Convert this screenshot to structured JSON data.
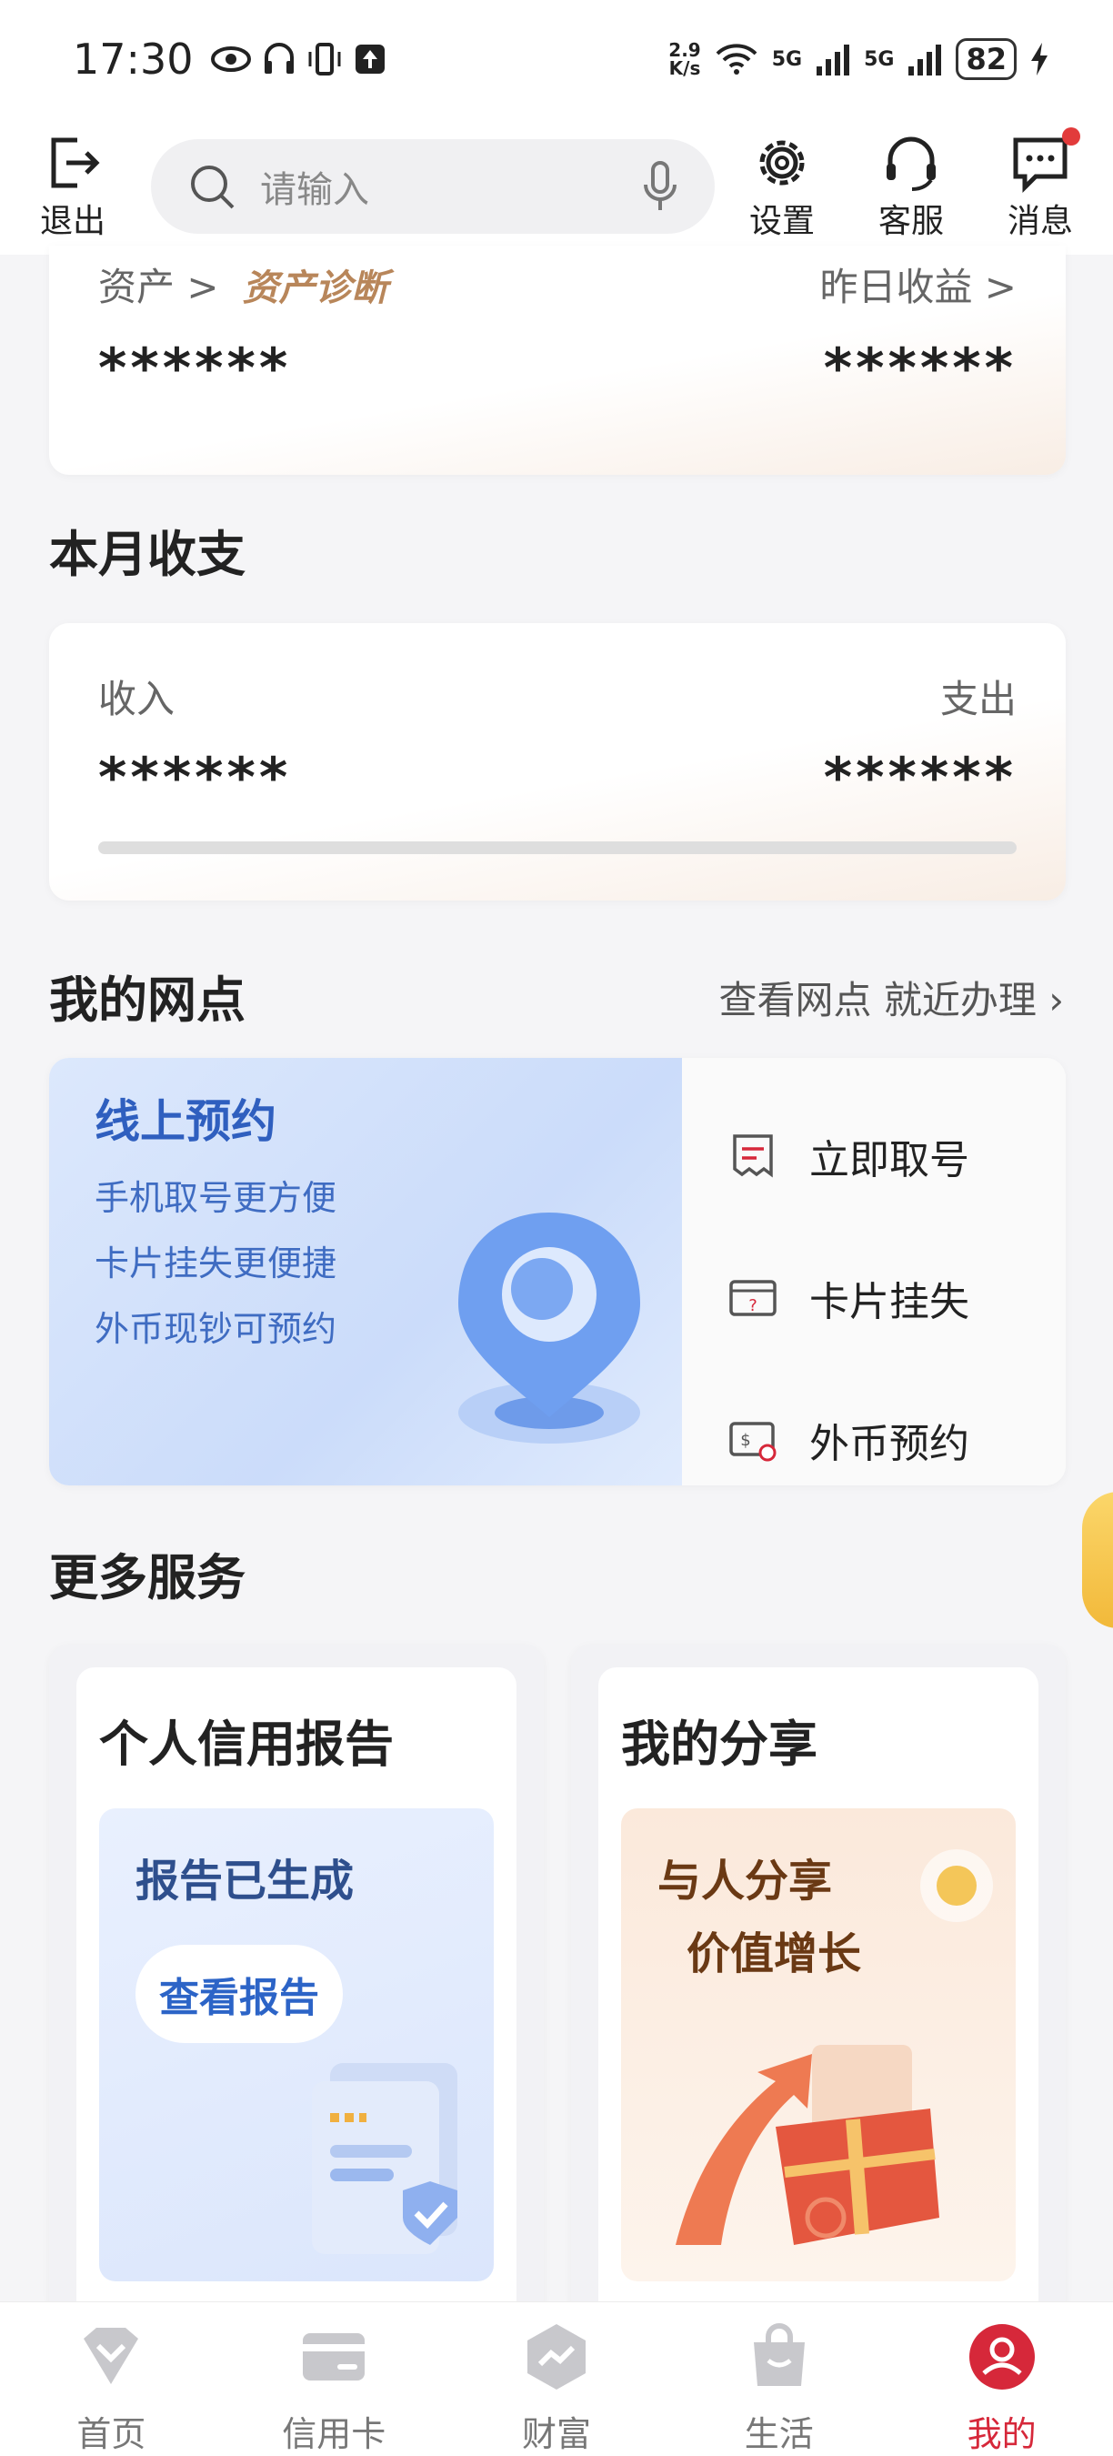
{
  "status_bar": {
    "time": "17:30",
    "speed_value": "2.9",
    "speed_unit": "K/s",
    "network1": "5G",
    "network2": "5G",
    "battery": "82"
  },
  "header": {
    "logout_label": "退出",
    "search_placeholder": "请输入",
    "settings_label": "设置",
    "service_label": "客服",
    "message_label": "消息"
  },
  "asset_card": {
    "asset_label": "资产 >",
    "diagnosis_label": "资产诊断",
    "yesterday_label": "昨日收益 >",
    "asset_value": "******",
    "yesterday_value": "******"
  },
  "monthly": {
    "title": "本月收支",
    "income_label": "收入",
    "expense_label": "支出",
    "income_value": "******",
    "expense_value": "******"
  },
  "branch": {
    "title": "我的网点",
    "link": "查看网点 就近办理",
    "online_title": "线上预约",
    "online_lines": [
      "手机取号更方便",
      "卡片挂失更便捷",
      "外币现钞可预约"
    ],
    "actions": [
      "立即取号",
      "卡片挂失",
      "外币预约"
    ]
  },
  "more_services": {
    "title": "更多服务",
    "credit_report": {
      "title": "个人信用报告",
      "banner_title": "报告已生成",
      "button": "查看报告"
    },
    "share": {
      "title": "我的分享",
      "line1": "与人分享",
      "line2": "价值增长"
    }
  },
  "tabbar": {
    "items": [
      {
        "label": "首页",
        "icon": "home-icon"
      },
      {
        "label": "信用卡",
        "icon": "credit-card-icon"
      },
      {
        "label": "财富",
        "icon": "wealth-icon"
      },
      {
        "label": "生活",
        "icon": "shopping-bag-icon"
      },
      {
        "label": "我的",
        "icon": "profile-icon"
      }
    ],
    "active_index": 4,
    "active_color": "#d6283a"
  }
}
